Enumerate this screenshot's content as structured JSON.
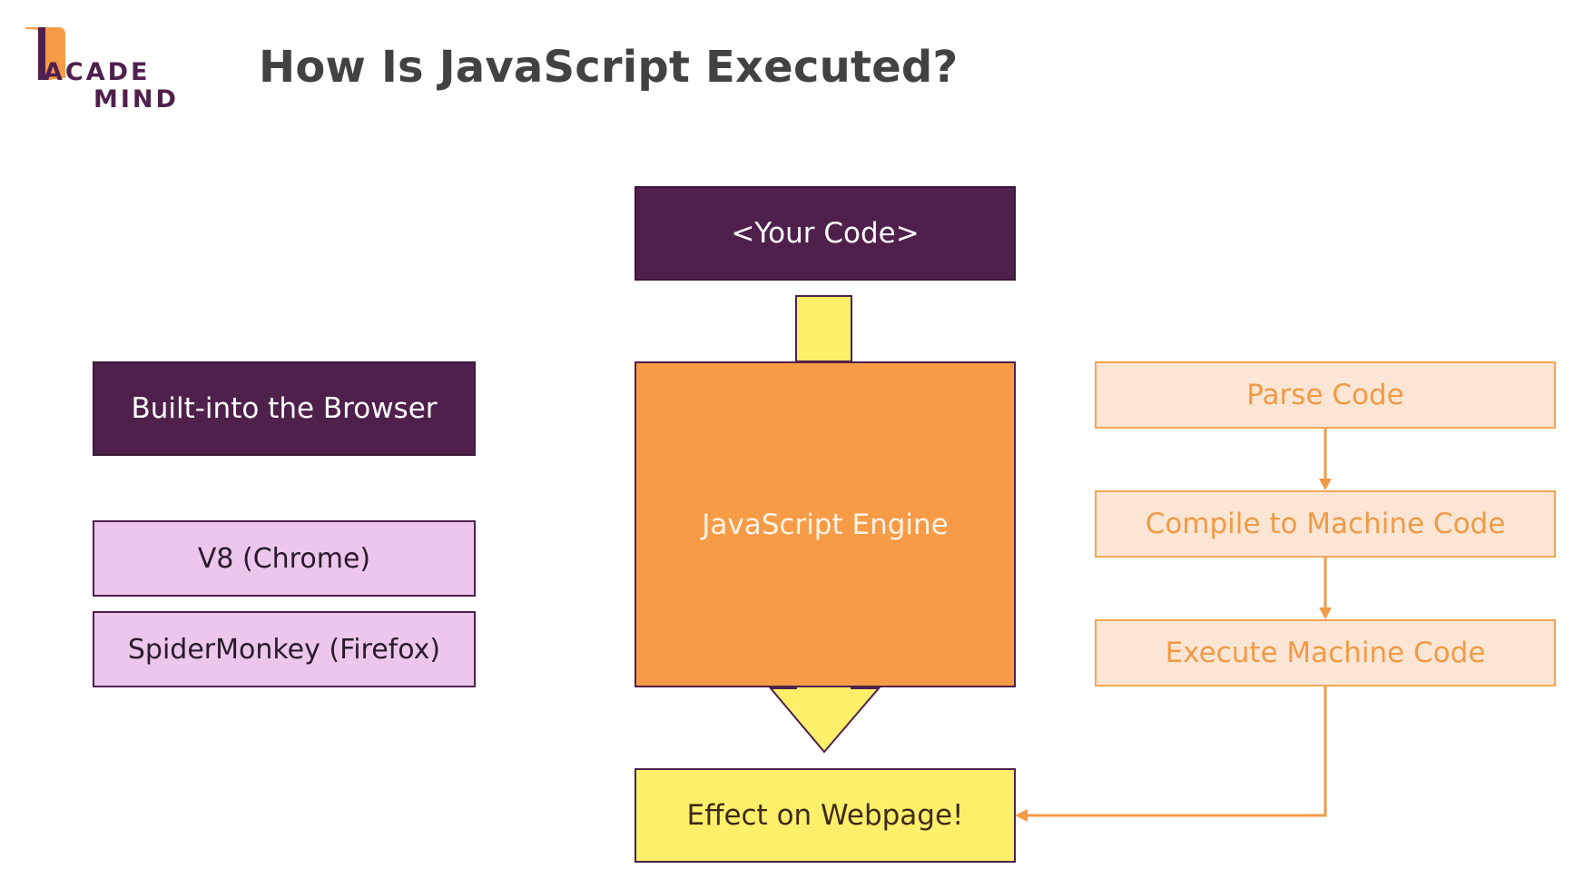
{
  "brand": {
    "logo_line1": "ACADE",
    "logo_line2": "MIND"
  },
  "title": "How Is JavaScript Executed?",
  "center": {
    "your_code": "<Your Code>",
    "engine": "JavaScript Engine",
    "effect": "Effect on Webpage!"
  },
  "left": {
    "heading": "Built-into the Browser",
    "engines": [
      "V8 (Chrome)",
      "SpiderMonkey (Firefox)"
    ]
  },
  "right": {
    "steps": [
      "Parse Code",
      "Compile to Machine Code",
      "Execute Machine Code"
    ]
  },
  "colors": {
    "dark_purple": "#50204c",
    "light_purple": "#ecc7eb",
    "orange": "#f79b46",
    "yellow": "#fcf06a",
    "peach": "#fbe6d5",
    "peach_text": "#f29a45",
    "title_gray": "#424242"
  }
}
